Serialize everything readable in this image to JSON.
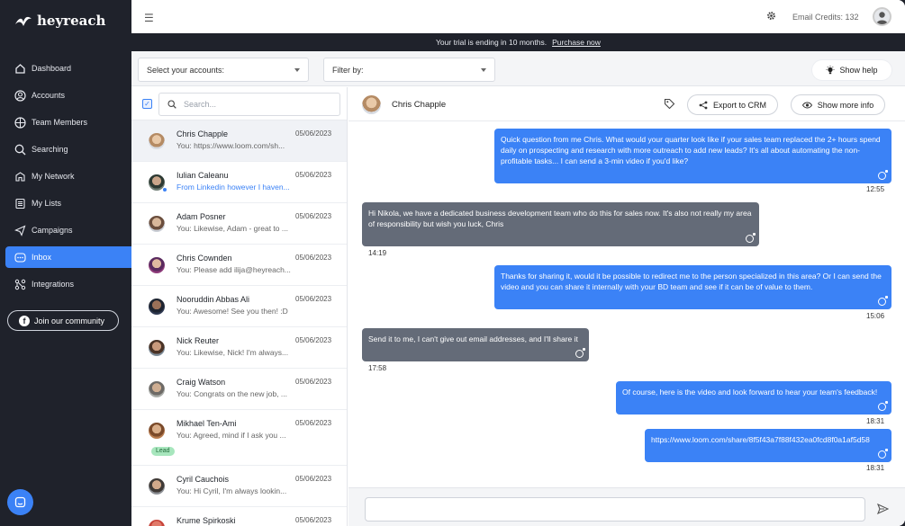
{
  "app": {
    "logo_text": "heyreach"
  },
  "sidebar": {
    "items": [
      {
        "label": "Dashboard",
        "icon": "dashboard-icon"
      },
      {
        "label": "Accounts",
        "icon": "accounts-icon"
      },
      {
        "label": "Team Members",
        "icon": "team-icon"
      },
      {
        "label": "Searching",
        "icon": "search-icon"
      },
      {
        "label": "My Network",
        "icon": "network-icon"
      },
      {
        "label": "My Lists",
        "icon": "lists-icon"
      },
      {
        "label": "Campaigns",
        "icon": "campaigns-icon"
      },
      {
        "label": "Inbox",
        "icon": "inbox-icon",
        "active": true
      },
      {
        "label": "Integrations",
        "icon": "integrations-icon"
      }
    ],
    "community": "Join our community"
  },
  "topbar": {
    "credits": "Email Credits: 132"
  },
  "trial": {
    "text": "Your trial is ending in 10 months.",
    "link": "Purchase now"
  },
  "filters": {
    "accounts": "Select your accounts:",
    "filter": "Filter by:",
    "help": "Show help"
  },
  "list": {
    "search_placeholder": "Search...",
    "rows": [
      {
        "name": "Chris Chapple",
        "date": "05/06/2023",
        "preview": "You: https://www.loom.com/sh...",
        "selected": true
      },
      {
        "name": "Iulian Caleanu",
        "date": "05/06/2023",
        "preview": "From Linkedin however I haven...",
        "unread": true
      },
      {
        "name": "Adam Posner",
        "date": "05/06/2023",
        "preview": "You: Likewise, Adam - great to ..."
      },
      {
        "name": "Chris Cownden",
        "date": "05/06/2023",
        "preview": "You: Please add ilija@heyreach..."
      },
      {
        "name": "Nooruddin Abbas Ali",
        "date": "05/06/2023",
        "preview": "You: Awesome! See you then! :D"
      },
      {
        "name": "Nick Reuter",
        "date": "05/06/2023",
        "preview": "You: Likewise, Nick! I'm always..."
      },
      {
        "name": "Craig Watson",
        "date": "05/06/2023",
        "preview": "You: Congrats on the new job, ..."
      },
      {
        "name": "Mikhael Ten-Ami",
        "date": "05/06/2023",
        "preview": "You: Agreed, mind if I ask you ...",
        "badge": "Lead"
      },
      {
        "name": "Cyril Cauchois",
        "date": "05/06/2023",
        "preview": "You: Hi Cyril, I'm always lookin..."
      },
      {
        "name": "Krume Spirkoski",
        "date": "05/06/2023",
        "preview": ""
      }
    ]
  },
  "chat": {
    "contact": "Chris Chapple",
    "export": "Export to CRM",
    "more": "Show more info",
    "messages": [
      {
        "dir": "out",
        "text": "Quick question from me Chris. What would your quarter look like if your sales team replaced the 2+ hours spend daily on prospecting and research with more outreach to add new leads? It's all about automating the non-profitable tasks... I can send a 3-min video if you'd like?",
        "time": "12:55"
      },
      {
        "dir": "in",
        "text": "Hi Nikola, we have a dedicated business development team who do this for sales now.  It's also not really my area of responsibility but wish you luck, Chris",
        "time": "14:19"
      },
      {
        "dir": "out",
        "text": "Thanks for sharing it, would it be possible to redirect me to the person specialized in this area? Or I can send the video and you can share it internally with your BD team and see if it can be of value to them.",
        "time": "15:06"
      },
      {
        "dir": "in",
        "text": "Send it to me, I can't give out email addresses, and I'll share it",
        "time": "17:58"
      },
      {
        "dir": "out",
        "text": "Of course, here is the video and look forward to hear your team's feedback!",
        "time": "18:31"
      },
      {
        "dir": "out",
        "text": "https://www.loom.com/share/8f5f43a7f88f432ea0fcd8f0a1af5d58",
        "time": "18:31"
      }
    ]
  }
}
